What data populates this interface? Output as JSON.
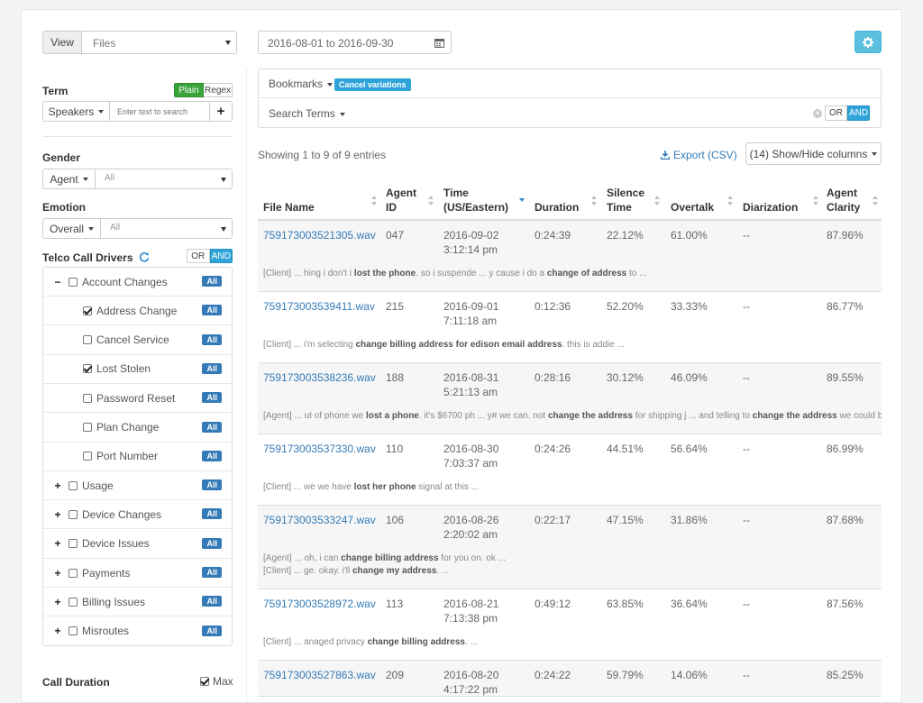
{
  "toolbar": {
    "view_label": "View",
    "view_select": "Files",
    "date_range": "2016-08-01 to 2016-09-30"
  },
  "filters": {
    "term": {
      "label": "Term",
      "plain": "Plain",
      "regex": "Regex",
      "scope": "Speakers",
      "placeholder": "Enter text to search",
      "add": "+"
    },
    "gender": {
      "label": "Gender",
      "scope": "Agent",
      "value": "All"
    },
    "emotion": {
      "label": "Emotion",
      "scope": "Overall",
      "value": "All"
    },
    "drivers": {
      "label": "Telco Call Drivers",
      "or": "OR",
      "and": "AND",
      "all_label": "All",
      "items": [
        {
          "label": "Account Changes",
          "toggle": "−",
          "checked": false,
          "child": false
        },
        {
          "label": "Address Change",
          "toggle": "",
          "checked": true,
          "child": true
        },
        {
          "label": "Cancel Service",
          "toggle": "",
          "checked": false,
          "child": true
        },
        {
          "label": "Lost Stolen",
          "toggle": "",
          "checked": true,
          "child": true
        },
        {
          "label": "Password Reset",
          "toggle": "",
          "checked": false,
          "child": true
        },
        {
          "label": "Plan Change",
          "toggle": "",
          "checked": false,
          "child": true
        },
        {
          "label": "Port Number",
          "toggle": "",
          "checked": false,
          "child": true
        },
        {
          "label": "Usage",
          "toggle": "+",
          "checked": false,
          "child": false
        },
        {
          "label": "Device Changes",
          "toggle": "+",
          "checked": false,
          "child": false
        },
        {
          "label": "Device Issues",
          "toggle": "+",
          "checked": false,
          "child": false
        },
        {
          "label": "Payments",
          "toggle": "+",
          "checked": false,
          "child": false
        },
        {
          "label": "Billing Issues",
          "toggle": "+",
          "checked": false,
          "child": false
        },
        {
          "label": "Misroutes",
          "toggle": "+",
          "checked": false,
          "child": false
        }
      ]
    },
    "duration": {
      "label": "Call Duration",
      "max": "Max"
    }
  },
  "bookmarks": {
    "label": "Bookmarks",
    "badge": "Cancel variations"
  },
  "search_terms": {
    "label": "Search Terms",
    "or": "OR",
    "and": "AND"
  },
  "table": {
    "info": "Showing 1 to 9 of 9 entries",
    "export": "Export (CSV)",
    "columns_btn": "(14) Show/Hide columns",
    "headers": [
      "File Name",
      "Agent ID",
      "Time (US/Eastern)",
      "Duration",
      "Silence Time",
      "Overtalk",
      "Diarization",
      "Agent Clarity"
    ],
    "rows": [
      {
        "file": "759173003521305.wav",
        "agent": "047",
        "date": "2016-09-02",
        "time": "3:12:14 pm",
        "duration": "0:24:39",
        "silence": "22.12%",
        "overtalk": "61.00%",
        "diar": "--",
        "clarity": "87.96%",
        "snippets": [
          [
            {
              "t": "[Client] ... hing i don't i "
            },
            {
              "t": "lost the phone",
              "b": true
            },
            {
              "t": ". so i suspende ... y cause i do a "
            },
            {
              "t": "change of address",
              "b": true
            },
            {
              "t": " to ..."
            }
          ]
        ]
      },
      {
        "file": "759173003539411.wav",
        "agent": "215",
        "date": "2016-09-01",
        "time": "7:11:18 am",
        "duration": "0:12:36",
        "silence": "52.20%",
        "overtalk": "33.33%",
        "diar": "--",
        "clarity": "86.77%",
        "snippets": [
          [
            {
              "t": "[Client] ... i'm selecting "
            },
            {
              "t": "change billing address for edison email address",
              "b": true
            },
            {
              "t": ". this is addie ..."
            }
          ]
        ]
      },
      {
        "file": "759173003538236.wav",
        "agent": "188",
        "date": "2016-08-31",
        "time": "5:21:13 am",
        "duration": "0:28:16",
        "silence": "30.12%",
        "overtalk": "46.09%",
        "diar": "--",
        "clarity": "89.55%",
        "snippets": [
          [
            {
              "t": "[Agent] ... ut of phone we "
            },
            {
              "t": "lost a phone",
              "b": true
            },
            {
              "t": ". it's $6700 ph ... y# we can. not "
            },
            {
              "t": "change the address",
              "b": true
            },
            {
              "t": " for shipping j ... and telling to "
            },
            {
              "t": "change the address",
              "b": true
            },
            {
              "t": " we could be"
            }
          ]
        ]
      },
      {
        "file": "759173003537330.wav",
        "agent": "110",
        "date": "2016-08-30",
        "time": "7:03:37 am",
        "duration": "0:24:26",
        "silence": "44.51%",
        "overtalk": "56.64%",
        "diar": "--",
        "clarity": "86.99%",
        "snippets": [
          [
            {
              "t": "[Client] ... we we have "
            },
            {
              "t": "lost her phone",
              "b": true
            },
            {
              "t": " signal at this ..."
            }
          ]
        ]
      },
      {
        "file": "759173003533247.wav",
        "agent": "106",
        "date": "2016-08-26",
        "time": "2:20:02 am",
        "duration": "0:22:17",
        "silence": "47.15%",
        "overtalk": "31.86%",
        "diar": "--",
        "clarity": "87.68%",
        "snippets": [
          [
            {
              "t": "[Agent] ... oh, i can "
            },
            {
              "t": "change billing address",
              "b": true
            },
            {
              "t": " for you on. ok ..."
            }
          ],
          [
            {
              "t": "[Client] ... ge. okay. i'll "
            },
            {
              "t": "change my address",
              "b": true
            },
            {
              "t": ". ..."
            }
          ]
        ]
      },
      {
        "file": "759173003528972.wav",
        "agent": "113",
        "date": "2016-08-21",
        "time": "7:13:38 pm",
        "duration": "0:49:12",
        "silence": "63.85%",
        "overtalk": "36.64%",
        "diar": "--",
        "clarity": "87.56%",
        "snippets": [
          [
            {
              "t": "[Client] ... anaged privacy "
            },
            {
              "t": "change billing address",
              "b": true
            },
            {
              "t": ". ..."
            }
          ]
        ]
      },
      {
        "file": "759173003527863.wav",
        "agent": "209",
        "date": "2016-08-20",
        "time": "4:17:22 pm",
        "duration": "0:24:22",
        "silence": "59.79%",
        "overtalk": "14.06%",
        "diar": "--",
        "clarity": "85.25%",
        "snippets": []
      }
    ]
  },
  "colors": {
    "accent": "#337ab7",
    "plain_green": "#3aa33a",
    "settings_blue": "#5bc0de",
    "badge_blue": "#2fa4d9"
  },
  "icons": [
    "calendar-icon",
    "gear-icon",
    "refresh-icon",
    "download-icon",
    "clear-icon",
    "sort-icon"
  ]
}
